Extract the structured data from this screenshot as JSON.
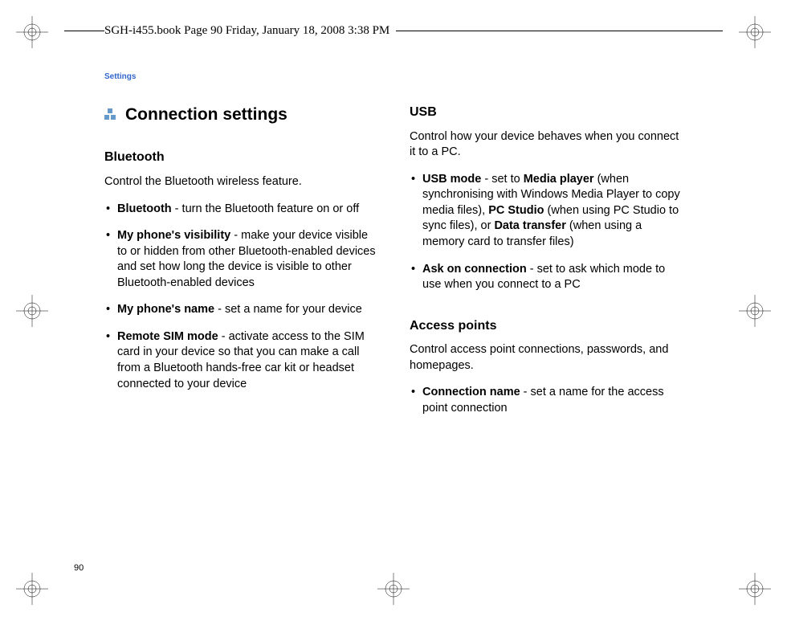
{
  "header": "SGH-i455.book  Page 90  Friday, January 18, 2008  3:38 PM",
  "section_label": "Settings",
  "page_number": "90",
  "main_heading": "Connection settings",
  "left": {
    "bluetooth": {
      "title": "Bluetooth",
      "intro": "Control the Bluetooth wireless feature.",
      "items": [
        {
          "term": "Bluetooth",
          "desc": " - turn the Bluetooth feature on or off"
        },
        {
          "term": "My phone's visibility",
          "desc": " - make your device visible to or hidden from other Bluetooth-enabled devices and set how long the device is visible to other Bluetooth-enabled devices"
        },
        {
          "term": "My phone's name",
          "desc": " - set a name for your device"
        },
        {
          "term": "Remote SIM mode",
          "desc": " - activate access to the SIM card in your device so that you can make a call from a Bluetooth hands-free car kit or headset connected to your device"
        }
      ]
    }
  },
  "right": {
    "usb": {
      "title": "USB",
      "intro": "Control how your device behaves when you connect it to a PC.",
      "items": [
        {
          "parts": [
            {
              "t": "USB mode",
              "b": true
            },
            {
              "t": " - set to "
            },
            {
              "t": "Media player",
              "b": true
            },
            {
              "t": " (when synchronising with Windows Media Player to copy media files), "
            },
            {
              "t": "PC Studio",
              "b": true
            },
            {
              "t": " (when using PC Studio to sync files), or "
            },
            {
              "t": "Data transfer",
              "b": true
            },
            {
              "t": " (when using a memory card to transfer files)"
            }
          ]
        },
        {
          "parts": [
            {
              "t": "Ask on connection",
              "b": true
            },
            {
              "t": " - set to ask which mode to use when you connect to a PC"
            }
          ]
        }
      ]
    },
    "access": {
      "title": "Access points",
      "intro": "Control access point connections, passwords, and homepages.",
      "items": [
        {
          "term": "Connection name",
          "desc": " - set a name for the access point connection"
        }
      ]
    }
  }
}
